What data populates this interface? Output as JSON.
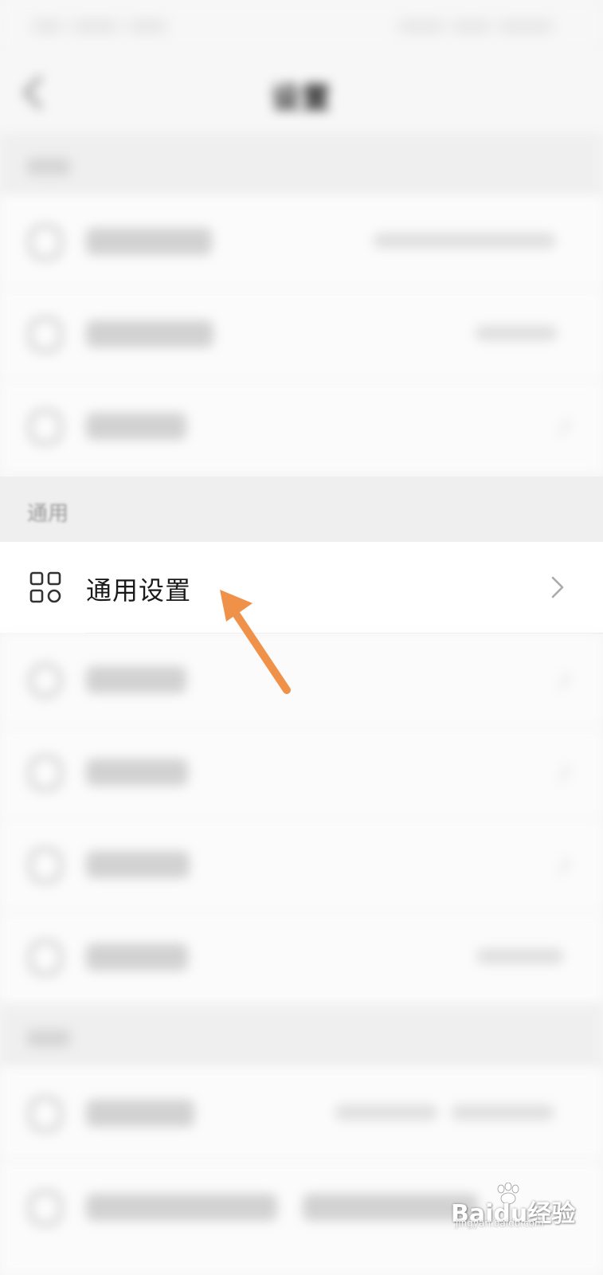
{
  "nav": {
    "title": "设置"
  },
  "sections": {
    "general_label": "通用"
  },
  "focus_row": {
    "label": "通用设置",
    "icon": "grid-apps-icon",
    "chevron": "chevron-right-icon"
  },
  "annotation": {
    "arrow_color": "#f0914a"
  },
  "watermark": {
    "text": "Baidu经验",
    "sub": "jingyan.baidu.com"
  },
  "colors": {
    "background": "#f6f6f6",
    "row_background": "#ffffff",
    "section_header": "#efefef",
    "section_label": "#9a9a9a",
    "icon_stroke": "#333333",
    "chevron": "#aaaaaa"
  }
}
